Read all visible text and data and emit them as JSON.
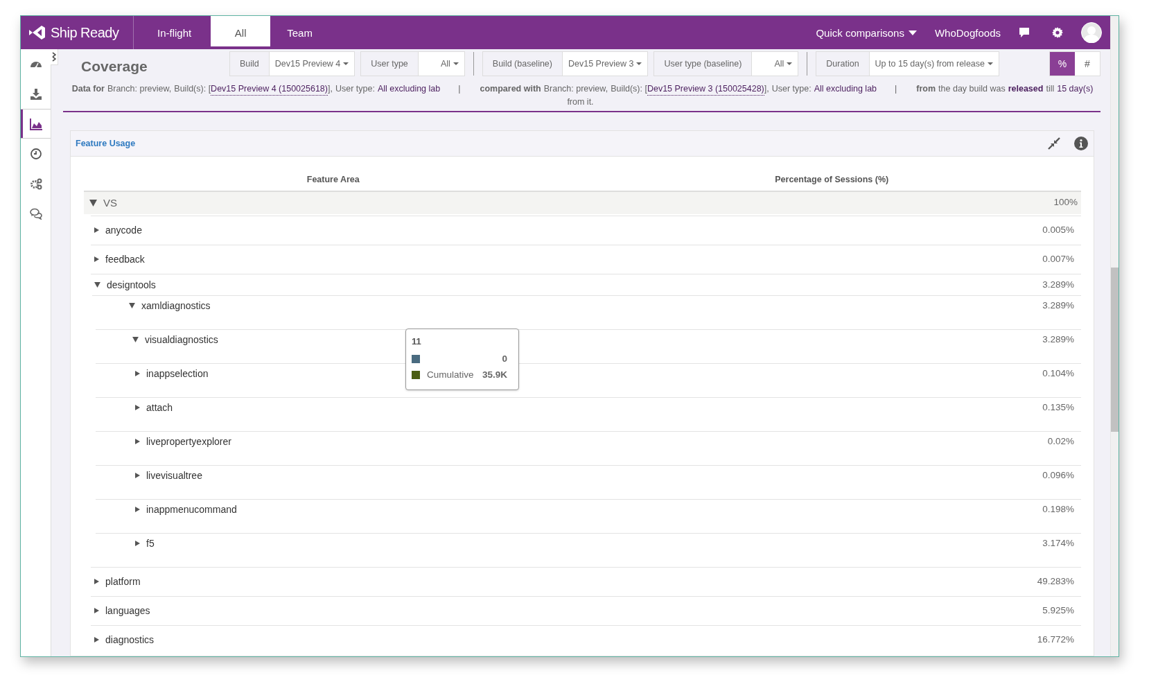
{
  "app": {
    "name": "Ship Ready"
  },
  "nav_tabs": [
    {
      "label": "In-flight",
      "selected": false
    },
    {
      "label": "All",
      "selected": true
    },
    {
      "label": "Team",
      "selected": false
    }
  ],
  "header": {
    "quick_comparisons": "Quick comparisons",
    "user": "WhoDogfoods"
  },
  "sidebar": {
    "items": [
      {
        "kind": "dashboard",
        "selected": false
      },
      {
        "kind": "download",
        "selected": false
      },
      {
        "kind": "chart",
        "selected": true
      },
      {
        "kind": "clock",
        "selected": false
      },
      {
        "kind": "gears",
        "selected": false
      },
      {
        "kind": "chat",
        "selected": false
      }
    ]
  },
  "page": {
    "title": "Coverage",
    "filter_groups": [
      [
        {
          "label": "Build",
          "value": "Dev15 Preview 4"
        },
        {
          "label": "User type",
          "value": "All"
        }
      ],
      [
        {
          "label": "Build (baseline)",
          "value": "Dev15 Preview 3"
        },
        {
          "label": "User type (baseline)",
          "value": "All"
        }
      ],
      [
        {
          "label": "Duration",
          "value": "Up to 15 day(s) from release"
        }
      ]
    ],
    "unit_toggle": [
      {
        "label": "%",
        "selected": true
      },
      {
        "label": "#",
        "selected": false
      }
    ],
    "info": [
      {
        "kind": "bold",
        "text": "Data for"
      },
      {
        "kind": "text",
        "text": "Branch: preview,"
      },
      {
        "kind": "text",
        "text": "Build(s): ["
      },
      {
        "kind": "link",
        "text": "Dev15 Preview 4 (150025618)"
      },
      {
        "kind": "text",
        "text": "],"
      },
      {
        "kind": "text",
        "text": "User type:"
      },
      {
        "kind": "value",
        "text": "All excluding lab"
      },
      {
        "kind": "sep",
        "text": "|"
      },
      {
        "kind": "bold",
        "text": "compared with"
      },
      {
        "kind": "text",
        "text": "Branch: preview,"
      },
      {
        "kind": "text",
        "text": "Build(s): ["
      },
      {
        "kind": "link",
        "text": "Dev15 Preview 3 (150025428)"
      },
      {
        "kind": "text",
        "text": "],"
      },
      {
        "kind": "text",
        "text": "User type:"
      },
      {
        "kind": "value",
        "text": "All excluding lab"
      },
      {
        "kind": "sep",
        "text": "|"
      },
      {
        "kind": "bold",
        "text": "from"
      },
      {
        "kind": "text",
        "text": "the day build was"
      },
      {
        "kind": "strong",
        "text": "released"
      },
      {
        "kind": "text",
        "text": "till"
      },
      {
        "kind": "value",
        "text": "15 day(s)"
      },
      {
        "kind": "text",
        "text": "from it."
      }
    ]
  },
  "panel": {
    "title": "Feature Usage",
    "columns": [
      "Feature Area",
      "Percentage of Sessions (%)"
    ],
    "rows": [
      {
        "label": "VS",
        "value": "100%",
        "expanded": true,
        "children": [
          {
            "label": "anycode",
            "value": "0.005%",
            "expanded": false
          },
          {
            "label": "feedback",
            "value": "0.007%",
            "expanded": false
          },
          {
            "label": "designtools",
            "value": "3.289%",
            "expanded": true,
            "children": [
              {
                "label": "xamldiagnostics",
                "value": "3.289%",
                "expanded": true,
                "children": [
                  {
                    "label": "visualdiagnostics",
                    "value": "3.289%",
                    "expanded": true,
                    "children": [
                      {
                        "label": "inappselection",
                        "value": "0.104%",
                        "expanded": false
                      },
                      {
                        "label": "attach",
                        "value": "0.135%",
                        "expanded": false
                      },
                      {
                        "label": "livepropertyexplorer",
                        "value": "0.02%",
                        "expanded": false
                      },
                      {
                        "label": "livevisualtree",
                        "value": "0.096%",
                        "expanded": false
                      },
                      {
                        "label": "inappmenucommand",
                        "value": "0.198%",
                        "expanded": false
                      },
                      {
                        "label": "f5",
                        "value": "3.174%",
                        "expanded": false
                      }
                    ]
                  }
                ]
              }
            ]
          },
          {
            "label": "platform",
            "value": "49.283%",
            "expanded": false
          },
          {
            "label": "languages",
            "value": "5.925%",
            "expanded": false
          },
          {
            "label": "diagnostics",
            "value": "16.772%",
            "expanded": false
          }
        ]
      }
    ],
    "tooltip": {
      "title": "11",
      "items": [
        {
          "color": "#4a6b80",
          "value": "0"
        },
        {
          "color": "#4b5e13",
          "label": "Cumulative",
          "value": "35.9K"
        }
      ]
    }
  }
}
